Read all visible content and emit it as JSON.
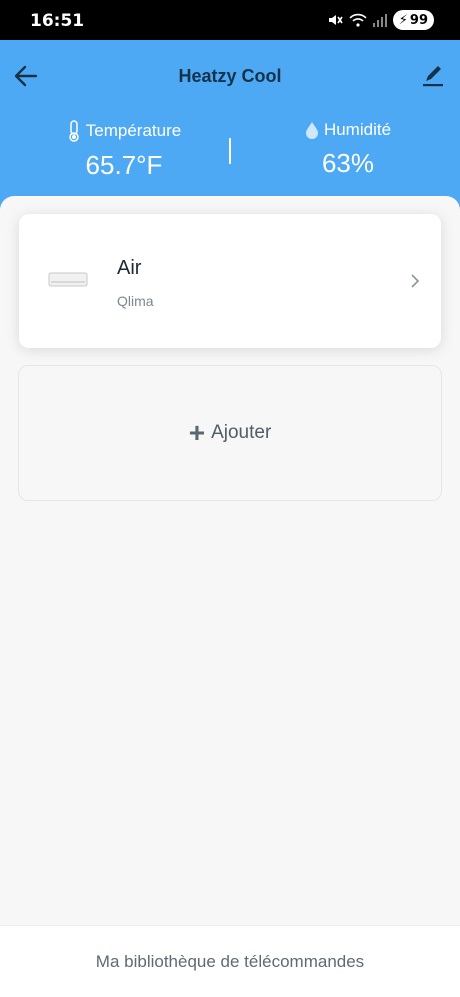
{
  "status_bar": {
    "time": "16:51",
    "battery": "99"
  },
  "header": {
    "title": "Heatzy Cool",
    "temperature": {
      "label": "Température",
      "value": "65.7°F"
    },
    "humidity": {
      "label": "Humidité",
      "value": "63%"
    }
  },
  "devices": [
    {
      "name": "Air",
      "brand": "Qlima",
      "icon": "air-conditioner-icon"
    }
  ],
  "add_button": {
    "label": "Ajouter"
  },
  "bottom": {
    "label": "Ma bibliothèque de télécommandes"
  },
  "colors": {
    "header_bg": "#4ea9f4",
    "title": "#15324a",
    "background": "#f7f7f7"
  }
}
